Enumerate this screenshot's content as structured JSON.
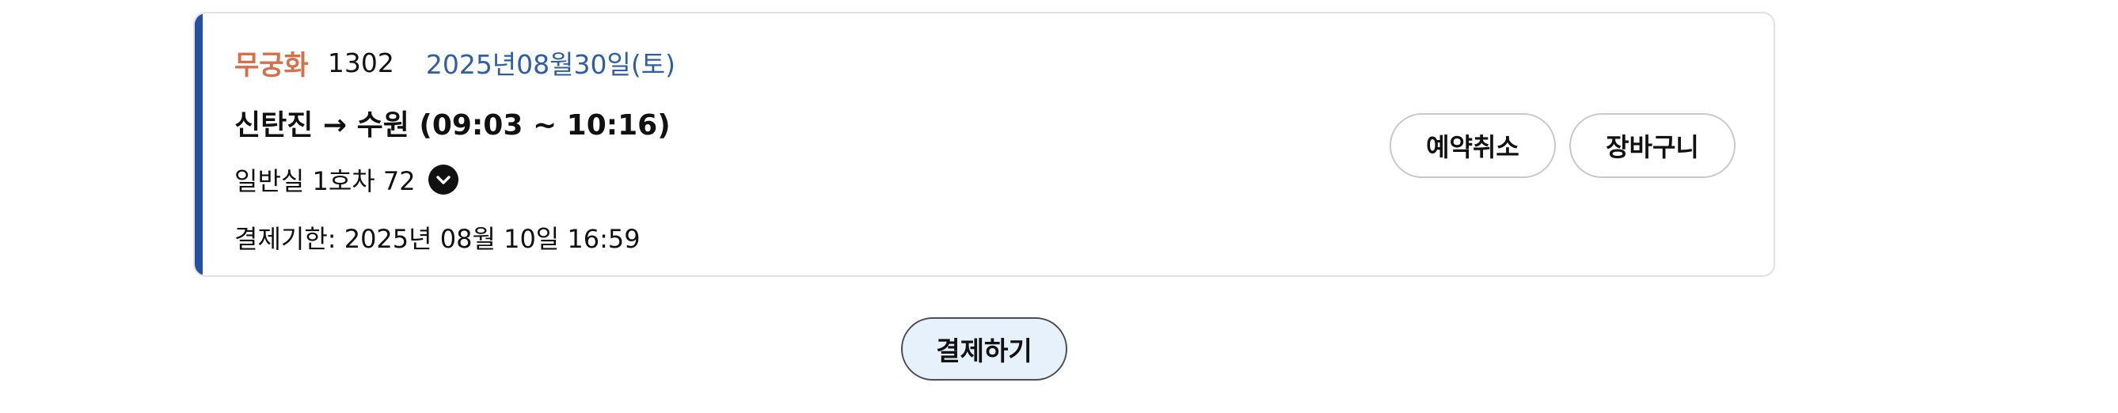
{
  "ticket": {
    "train_type": "무궁화",
    "train_number": "1302",
    "travel_date": "2025년08월30일(토)",
    "route": "신탄진 → 수원 (09:03 ~ 10:16)",
    "seat": "일반실 1호차 72",
    "payment_deadline": "결제기한: 2025년 08월 10일 16:59",
    "actions": {
      "cancel_label": "예약취소",
      "cart_label": "장바구니"
    }
  },
  "footer": {
    "pay_label": "결제하기"
  },
  "colors": {
    "accent_bar": "#2350a3",
    "train_type": "#d5704a",
    "travel_date": "#2e5ea6",
    "pay_button_bg": "#e7f1fb"
  },
  "icons": {
    "seat_expand": "chevron-down-circle-icon"
  }
}
